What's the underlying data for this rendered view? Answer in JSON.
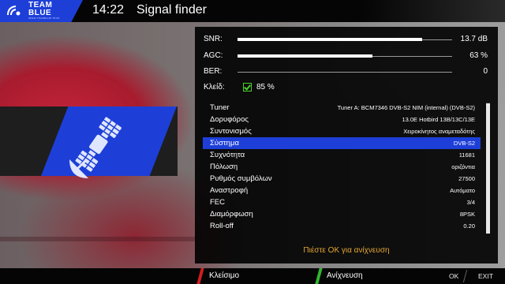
{
  "brand": {
    "line1": "TEAM",
    "line2": "BLUE",
    "tagline": "WWW.TEAMBLUE.TECH"
  },
  "header": {
    "clock": "14:22",
    "title": "Signal finder"
  },
  "meters": [
    {
      "label": "SNR:",
      "value_text": "13.7 dB",
      "fill": 0.86
    },
    {
      "label": "AGC:",
      "value_text": "63 %",
      "fill": 0.63
    },
    {
      "label": "BER:",
      "value_text": "0",
      "fill": 0.0
    }
  ],
  "lock": {
    "label": "Κλείδ:",
    "checked": true,
    "value_text": "85 %"
  },
  "details": [
    {
      "key": "Tuner",
      "value": "Tuner A: BCM7346 DVB-S2 NIM (internal) (DVB-S2)"
    },
    {
      "key": "Δορυφόρος",
      "value": "13.0E Hotbird 13B/13C/13E"
    },
    {
      "key": "Συντονισμός",
      "value": "Χειροκίνητος αναμεταδότης"
    },
    {
      "key": "Σύστημα",
      "value": "DVB-S2",
      "selected": true
    },
    {
      "key": "Συχνότητα",
      "value": "11681"
    },
    {
      "key": "Πόλωση",
      "value": "οριζόντια"
    },
    {
      "key": "Ρυθμός συμβόλων",
      "value": "27500"
    },
    {
      "key": "Αναστροφή",
      "value": "Αυτόματο"
    },
    {
      "key": "FEC",
      "value": "3/4"
    },
    {
      "key": "Διαμόρφωση",
      "value": "8PSK"
    },
    {
      "key": "Roll-off",
      "value": "0.20"
    }
  ],
  "hint": "Πιέστε OK για ανίχνευση",
  "footer": {
    "red_label": "Κλείσιμο",
    "green_label": "Ανίχνευση",
    "ok_key": "OK",
    "exit_key": "EXIT"
  },
  "colors": {
    "accent_blue": "#1d3fd8",
    "red": "#d21e1e",
    "green": "#31b52f",
    "hint": "#e6a733",
    "check": "#4ccf2a"
  }
}
